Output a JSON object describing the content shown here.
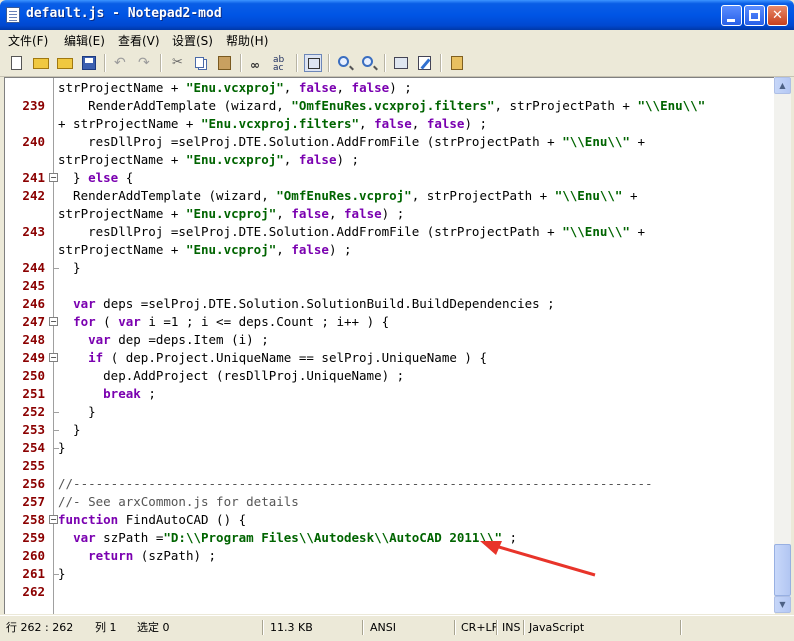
{
  "window": {
    "title": "default.js - Notepad2-mod"
  },
  "menu": [
    "文件(F)",
    "编辑(E)",
    "查看(V)",
    "设置(S)",
    "帮助(H)"
  ],
  "toolbar_icons": [
    "new-icon",
    "open-icon",
    "browse-icon",
    "save-icon",
    "undo-icon",
    "redo-icon",
    "cut-icon",
    "copy-icon",
    "paste-icon",
    "find-icon",
    "replace-icon",
    "word-wrap-icon",
    "zoom-in-icon",
    "zoom-out-icon",
    "scheme-icon",
    "customize-icon",
    "exit-icon"
  ],
  "editor": {
    "lines": [
      {
        "num": "",
        "fold": "",
        "tokens": [
          [
            "n",
            "strProjectName + "
          ],
          [
            "s",
            "\"Enu.vcxproj\""
          ],
          [
            "n",
            ", "
          ],
          [
            "l",
            "false"
          ],
          [
            "n",
            ", "
          ],
          [
            "l",
            "false"
          ],
          [
            "n",
            ") ;"
          ]
        ]
      },
      {
        "num": "239",
        "fold": "",
        "tokens": [
          [
            "n",
            "    RenderAddTemplate (wizard, "
          ],
          [
            "s",
            "\"OmfEnuRes.vcxproj.filters\""
          ],
          [
            "n",
            ", strProjectPath + "
          ],
          [
            "s",
            "\"\\\\Enu\\\\\""
          ]
        ]
      },
      {
        "num": "",
        "fold": "",
        "tokens": [
          [
            "n",
            "+ strProjectName + "
          ],
          [
            "s",
            "\"Enu.vcxproj.filters\""
          ],
          [
            "n",
            ", "
          ],
          [
            "l",
            "false"
          ],
          [
            "n",
            ", "
          ],
          [
            "l",
            "false"
          ],
          [
            "n",
            ") ;"
          ]
        ]
      },
      {
        "num": "240",
        "fold": "",
        "tokens": [
          [
            "n",
            "    resDllProj =selProj.DTE.Solution.AddFromFile (strProjectPath + "
          ],
          [
            "s",
            "\"\\\\Enu\\\\\""
          ],
          [
            "n",
            " +"
          ]
        ]
      },
      {
        "num": "",
        "fold": "",
        "tokens": [
          [
            "n",
            "strProjectName + "
          ],
          [
            "s",
            "\"Enu.vcxproj\""
          ],
          [
            "n",
            ", "
          ],
          [
            "l",
            "false"
          ],
          [
            "n",
            ") ;"
          ]
        ]
      },
      {
        "num": "241",
        "fold": "-",
        "tokens": [
          [
            "n",
            "  } "
          ],
          [
            "k",
            "else"
          ],
          [
            "n",
            " {"
          ]
        ]
      },
      {
        "num": "242",
        "fold": "",
        "tokens": [
          [
            "n",
            "  RenderAddTemplate (wizard, "
          ],
          [
            "s",
            "\"OmfEnuRes.vcproj\""
          ],
          [
            "n",
            ", strProjectPath + "
          ],
          [
            "s",
            "\"\\\\Enu\\\\\""
          ],
          [
            "n",
            " +"
          ]
        ]
      },
      {
        "num": "",
        "fold": "",
        "tokens": [
          [
            "n",
            "strProjectName + "
          ],
          [
            "s",
            "\"Enu.vcproj\""
          ],
          [
            "n",
            ", "
          ],
          [
            "l",
            "false"
          ],
          [
            "n",
            ", "
          ],
          [
            "l",
            "false"
          ],
          [
            "n",
            ") ;"
          ]
        ]
      },
      {
        "num": "243",
        "fold": "",
        "tokens": [
          [
            "n",
            "    resDllProj =selProj.DTE.Solution.AddFromFile (strProjectPath + "
          ],
          [
            "s",
            "\"\\\\Enu\\\\\""
          ],
          [
            "n",
            " +"
          ]
        ]
      },
      {
        "num": "",
        "fold": "",
        "tokens": [
          [
            "n",
            "strProjectName + "
          ],
          [
            "s",
            "\"Enu.vcproj\""
          ],
          [
            "n",
            ", "
          ],
          [
            "l",
            "false"
          ],
          [
            "n",
            ") ;"
          ]
        ]
      },
      {
        "num": "244",
        "fold": "end",
        "tokens": [
          [
            "n",
            "  }"
          ]
        ]
      },
      {
        "num": "245",
        "fold": "",
        "tokens": []
      },
      {
        "num": "246",
        "fold": "",
        "tokens": [
          [
            "n",
            "  "
          ],
          [
            "k",
            "var"
          ],
          [
            "n",
            " deps =selProj.DTE.Solution.SolutionBuild.BuildDependencies ;"
          ]
        ]
      },
      {
        "num": "247",
        "fold": "-",
        "tokens": [
          [
            "n",
            "  "
          ],
          [
            "k",
            "for"
          ],
          [
            "n",
            " ( "
          ],
          [
            "k",
            "var"
          ],
          [
            "n",
            " i =1 ; i <= deps.Count ; i++ ) {"
          ]
        ]
      },
      {
        "num": "248",
        "fold": "",
        "tokens": [
          [
            "n",
            "    "
          ],
          [
            "k",
            "var"
          ],
          [
            "n",
            " dep =deps.Item (i) ;"
          ]
        ]
      },
      {
        "num": "249",
        "fold": "-",
        "tokens": [
          [
            "n",
            "    "
          ],
          [
            "k",
            "if"
          ],
          [
            "n",
            " ( dep.Project.UniqueName == selProj.UniqueName ) {"
          ]
        ]
      },
      {
        "num": "250",
        "fold": "",
        "tokens": [
          [
            "n",
            "      dep.AddProject (resDllProj.UniqueName) ;"
          ]
        ]
      },
      {
        "num": "251",
        "fold": "",
        "tokens": [
          [
            "n",
            "      "
          ],
          [
            "k",
            "break"
          ],
          [
            "n",
            " ;"
          ]
        ]
      },
      {
        "num": "252",
        "fold": "end",
        "tokens": [
          [
            "n",
            "    }"
          ]
        ]
      },
      {
        "num": "253",
        "fold": "end",
        "tokens": [
          [
            "n",
            "  }"
          ]
        ]
      },
      {
        "num": "254",
        "fold": "end",
        "tokens": [
          [
            "n",
            "}"
          ]
        ]
      },
      {
        "num": "255",
        "fold": "",
        "tokens": []
      },
      {
        "num": "256",
        "fold": "",
        "tokens": [
          [
            "c",
            "//-----------------------------------------------------------------------------"
          ]
        ]
      },
      {
        "num": "257",
        "fold": "",
        "tokens": [
          [
            "c",
            "//- See arxCommon.js for details"
          ]
        ]
      },
      {
        "num": "258",
        "fold": "-",
        "tokens": [
          [
            "k",
            "function"
          ],
          [
            "n",
            " FindAutoCAD () {"
          ]
        ]
      },
      {
        "num": "259",
        "fold": "",
        "tokens": [
          [
            "n",
            "  "
          ],
          [
            "k",
            "var"
          ],
          [
            "n",
            " szPath ="
          ],
          [
            "s",
            "\"D:\\\\Program Files\\\\Autodesk\\\\AutoCAD 2011\\\\\""
          ],
          [
            "n",
            " ;"
          ]
        ]
      },
      {
        "num": "260",
        "fold": "",
        "tokens": [
          [
            "n",
            "    "
          ],
          [
            "k",
            "return"
          ],
          [
            "n",
            " (szPath) ;"
          ]
        ]
      },
      {
        "num": "261",
        "fold": "end",
        "tokens": [
          [
            "n",
            "}"
          ]
        ]
      },
      {
        "num": "262",
        "fold": "",
        "tokens": []
      }
    ]
  },
  "status": {
    "position": "行 262 : 262",
    "column": "列 1",
    "selection": "选定 0",
    "size": "11.3 KB",
    "encoding": "ANSI",
    "eol": "CR+LF",
    "ins": "INS",
    "lexer": "JavaScript"
  },
  "colors": {
    "keyword": "#7a00b0",
    "string": "#006400",
    "linenumber": "#8b0000",
    "arrow": "#e8342a"
  }
}
